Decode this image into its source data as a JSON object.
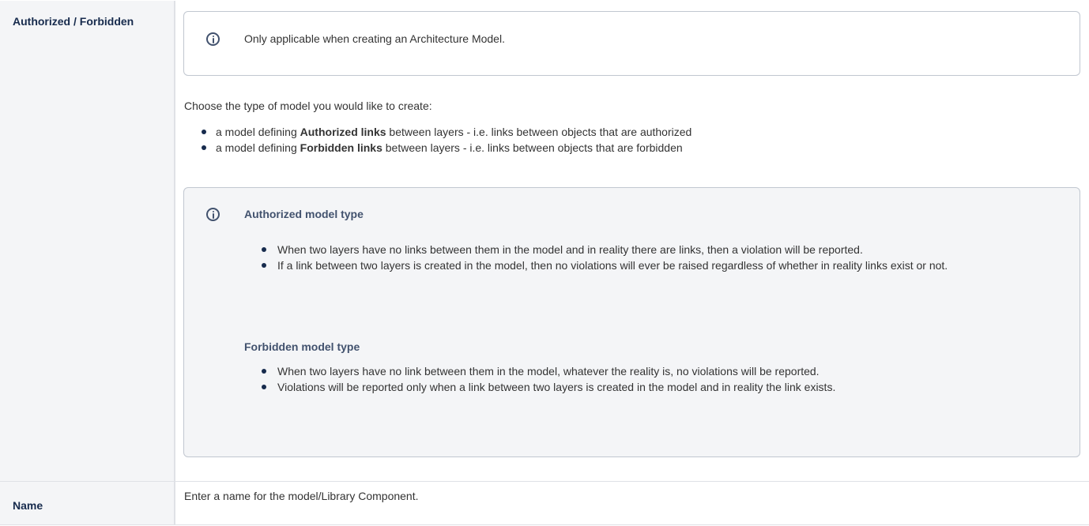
{
  "rows": [
    {
      "header": "Authorized / Forbidden"
    },
    {
      "header": "Name",
      "description": "Enter a name for the model/Library Component."
    }
  ],
  "note_top": {
    "icon": "info-icon",
    "text": "Only applicable when creating an Architecture Model."
  },
  "intro": "Choose the type of model you would like to create:",
  "options": [
    {
      "prefix": "a model defining ",
      "bold": "Authorized links",
      "suffix": " between layers - i.e. links between objects that are authorized"
    },
    {
      "prefix": "a model defining ",
      "bold": "Forbidden links",
      "suffix": " between layers - i.e. links between objects that are forbidden"
    }
  ],
  "note_types": {
    "icon": "info-icon",
    "authorized": {
      "title": "Authorized model type",
      "items": [
        "When two layers have no links between them in the model and in reality there are links, then a violation will be reported.",
        "If a link between two layers is created in the model, then no violations will ever be raised regardless of whether in reality links exist or not."
      ]
    },
    "forbidden": {
      "title": "Forbidden model type",
      "items": [
        "When two layers have no link between them in the model, whatever the reality is, no violations will be reported.",
        "Violations will be reported only when a link between two layers is created in the model and in reality the link exists."
      ]
    }
  }
}
